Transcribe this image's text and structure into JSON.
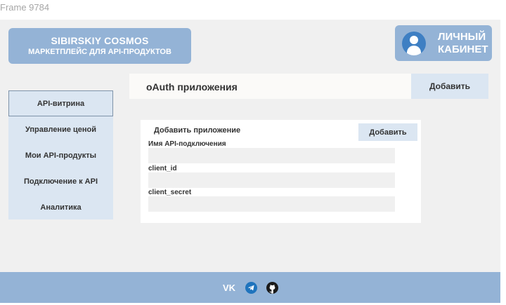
{
  "frame": {
    "label": "Frame 9784"
  },
  "brand": {
    "title": "SIBIRSKIY COSMOS",
    "subtitle": "МАРКЕТПЛЕЙС ДЛЯ API-ПРОДУКТОВ"
  },
  "account": {
    "label_line1": "ЛИЧНЫЙ",
    "label_line2": "КАБИНЕТ",
    "icon": "user-avatar-icon"
  },
  "page": {
    "title": "oAuth приложения",
    "add_button": "Добавить"
  },
  "sidebar": {
    "items": [
      {
        "label": "API-витрина",
        "active": true
      },
      {
        "label": "Управление ценой",
        "active": false
      },
      {
        "label": "Мои API-продукты",
        "active": false
      },
      {
        "label": "Подключение к API",
        "active": false
      },
      {
        "label": "Аналитика",
        "active": false
      }
    ]
  },
  "form": {
    "title": "Добавить приложение",
    "submit": "Добавить",
    "fields": [
      {
        "label": "Имя API-подключения",
        "value": ""
      },
      {
        "label": "client_id",
        "value": ""
      },
      {
        "label": "client_secret",
        "value": ""
      }
    ]
  },
  "footer": {
    "icons": [
      "vk-icon",
      "telegram-icon",
      "github-icon"
    ]
  },
  "colors": {
    "accent": "#94b3d6",
    "light_accent": "#dbe6f2",
    "background": "#f0f0f0",
    "avatar": "#3e7fc3"
  }
}
